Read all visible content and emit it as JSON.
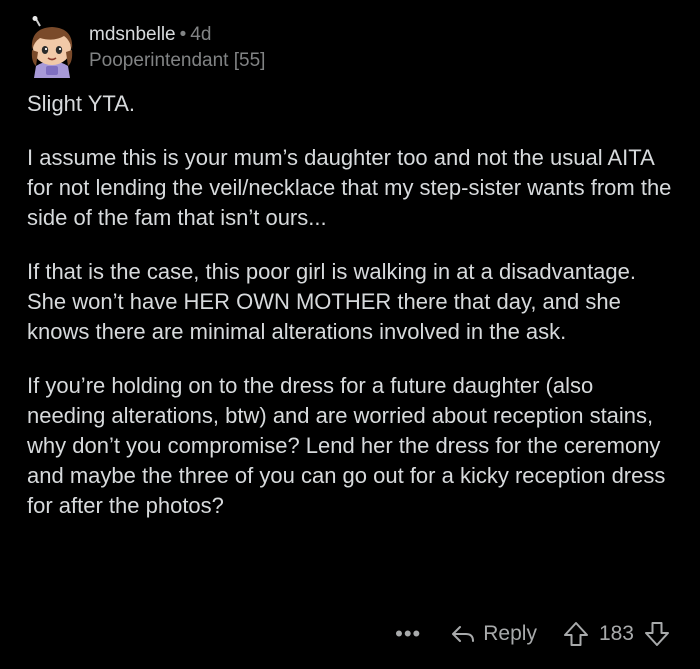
{
  "comment": {
    "username": "mdsnbelle",
    "separator": "•",
    "age": "4d",
    "flair": "Pooperintendant [55]",
    "paragraphs": [
      "Slight YTA.",
      "I assume this is your mum’s daughter too and not the usual AITA for not lending the veil/necklace that my step-sister wants from the side of the fam that isn’t ours...",
      "If that is the case, this poor girl is walking in at a disadvantage. She won’t have HER OWN MOTHER there that day, and she knows there are minimal alterations involved in the ask.",
      "If you’re holding on to the dress for a future daughter (also needing alterations, btw) and are worried about reception stains, why don’t you compromise? Lend her the dress for the ceremony and maybe the three of you can go out for a kicky reception dress for after the photos?"
    ]
  },
  "actions": {
    "more": "•••",
    "reply_label": "Reply",
    "score": "183"
  },
  "icons": {
    "avatar": "user-avatar",
    "reply": "reply-arrow-icon",
    "upvote": "upvote-arrow-icon",
    "downvote": "downvote-arrow-icon"
  },
  "colors": {
    "background": "#000000",
    "text": "#d7dadc",
    "meta": "#818384"
  }
}
